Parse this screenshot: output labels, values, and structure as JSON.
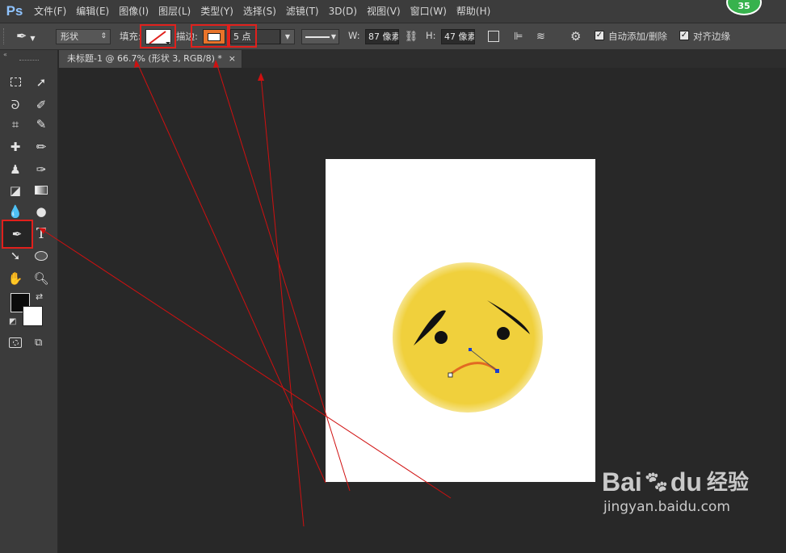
{
  "app": {
    "logo": "Ps",
    "badge_count": "35"
  },
  "menu": [
    "文件(F)",
    "编辑(E)",
    "图像(I)",
    "图层(L)",
    "类型(Y)",
    "选择(S)",
    "滤镜(T)",
    "3D(D)",
    "视图(V)",
    "窗口(W)",
    "帮助(H)"
  ],
  "options": {
    "tool_icon": "pen-icon",
    "mode_value": "形状",
    "fill_label": "填充:",
    "stroke_label": "描边:",
    "stroke_color": "#e8732a",
    "stroke_width_value": "5 点",
    "width_label": "W:",
    "width_value": "87 像素",
    "height_label": "H:",
    "height_value": "47 像素",
    "auto_add_delete_label": "自动添加/删除",
    "align_edges_label": "对齐边缘",
    "auto_add_delete_checked": true,
    "align_edges_checked": true
  },
  "document": {
    "tab_title": "未标题-1 @ 66.7% (形状 3, RGB/8) *",
    "close_glyph": "×"
  },
  "toolbox": {
    "tools": [
      "rectangular-marquee-icon",
      "move-icon",
      "lasso-icon",
      "quick-selection-icon",
      "crop-icon",
      "eyedropper-icon",
      "healing-brush-icon",
      "brush-icon",
      "clone-stamp-icon",
      "history-brush-icon",
      "eraser-icon",
      "gradient-icon",
      "blur-icon",
      "dodge-icon",
      "pen-icon",
      "type-icon",
      "path-selection-icon",
      "ellipse-icon",
      "hand-icon",
      "zoom-icon"
    ],
    "foreground_color": "#0b0b0b",
    "background_color": "#ffffff"
  },
  "artwork": {
    "face_color": "#f0d03c",
    "mouth_color": "#e26a22",
    "feature_color": "#111111"
  },
  "watermark": {
    "brand": "Bai",
    "brand_suffix": "du",
    "product": "经验",
    "url": "jingyan.baidu.com"
  }
}
